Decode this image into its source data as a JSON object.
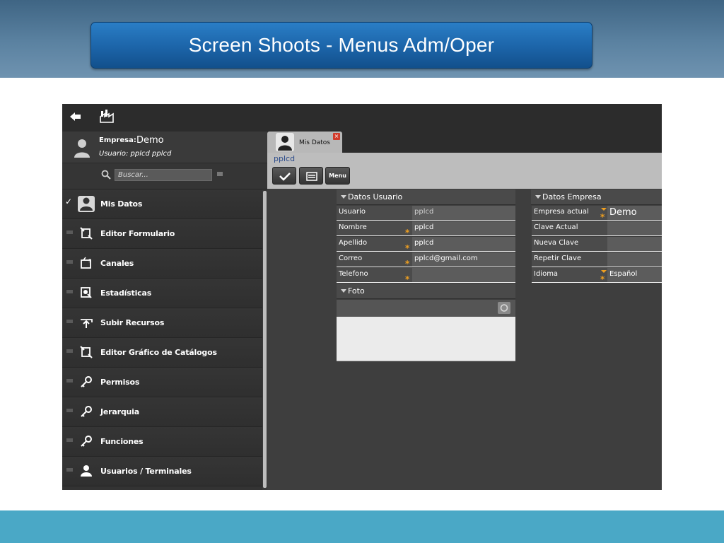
{
  "slide": {
    "title": "Screen Shoots - Menus Adm/Oper",
    "colors": {
      "header_band": "#5b82a1",
      "title_box": "#1c64a8",
      "footer_band": "#4aa8c6"
    }
  },
  "app": {
    "topbar": {
      "back_icon": "arrow-left-icon",
      "home_icon": "factory-icon"
    },
    "user": {
      "empresa_label": "Empresa:",
      "empresa_value": "Demo",
      "usuario_line": "Usuario: pplcd pplcd"
    },
    "search": {
      "placeholder": "Buscar..."
    },
    "menu": [
      {
        "label": "Mis Datos",
        "icon": "user-icon",
        "active": true
      },
      {
        "label": "Editor Formulario",
        "icon": "form-edit-icon",
        "active": false
      },
      {
        "label": "Canales",
        "icon": "channel-icon",
        "active": false
      },
      {
        "label": "Estadísticas",
        "icon": "stats-icon",
        "active": false
      },
      {
        "label": "Subir Recursos",
        "icon": "upload-icon",
        "active": false
      },
      {
        "label": "Editor Gráfico de Catálogos",
        "icon": "catalog-edit-icon",
        "active": false
      },
      {
        "label": "Permisos",
        "icon": "key-icon",
        "active": false
      },
      {
        "label": "Jerarquia",
        "icon": "key-icon",
        "active": false
      },
      {
        "label": "Funciones",
        "icon": "key-icon",
        "active": false
      },
      {
        "label": "Usuarios / Terminales",
        "icon": "user-icon",
        "active": false
      }
    ],
    "tab": {
      "label": "Mis Datos",
      "close": "×"
    },
    "breadcrumb": "pplcd",
    "toolbar": {
      "menu_label": "Menu"
    },
    "datos_usuario": {
      "title": "Datos Usuario",
      "rows": [
        {
          "label": "Usuario",
          "value": "pplcd",
          "required": false
        },
        {
          "label": "Nombre",
          "value": "pplcd",
          "required": true
        },
        {
          "label": "Apellido",
          "value": "pplcd",
          "required": true
        },
        {
          "label": "Correo",
          "value": "pplcd@gmail.com",
          "required": true
        },
        {
          "label": "Telefono",
          "value": "",
          "required": true
        }
      ]
    },
    "foto": {
      "title": "Foto"
    },
    "datos_empresa": {
      "title": "Datos Empresa",
      "rows": [
        {
          "label": "Empresa actual",
          "value": "Demo",
          "dropdown": true
        },
        {
          "label": "Clave Actual",
          "value": "",
          "dropdown": false
        },
        {
          "label": "Nueva  Clave",
          "value": "",
          "dropdown": false
        },
        {
          "label": "Repetir Clave",
          "value": "",
          "dropdown": false
        },
        {
          "label": "Idioma",
          "value": "Español",
          "dropdown": true
        }
      ]
    }
  }
}
